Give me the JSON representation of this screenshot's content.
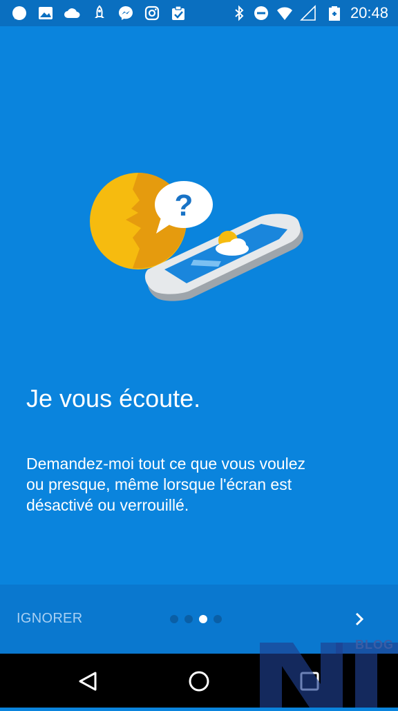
{
  "status_bar": {
    "time": "20:48",
    "left_icons": [
      "chat-bubble-icon",
      "image-icon",
      "cloud-icon",
      "rocket-icon",
      "messenger-icon",
      "instagram-icon",
      "clipboard-check-icon"
    ],
    "right_icons": [
      "bluetooth-icon",
      "do-not-disturb-icon",
      "wifi-icon",
      "signal-icon",
      "battery-charging-icon"
    ]
  },
  "onboarding": {
    "title": "Je vous écoute.",
    "description": "Demandez-moi tout ce que vous voulez\nou presque, même lorsque l'écran est\ndésactivé ou verrouillé."
  },
  "bottom_bar": {
    "skip_label": "IGNORER",
    "page_indicator": {
      "total": 4,
      "current": 3
    }
  },
  "nav_bar": {
    "buttons": [
      "back-icon",
      "home-icon",
      "recents-icon"
    ]
  },
  "watermark": {
    "label": "BLOG"
  },
  "colors": {
    "background": "#0a84dd",
    "status_bar": "#0a6fc0",
    "bottom_bar": "#0a78cf",
    "accent_yellow": "#f6bb0f"
  }
}
